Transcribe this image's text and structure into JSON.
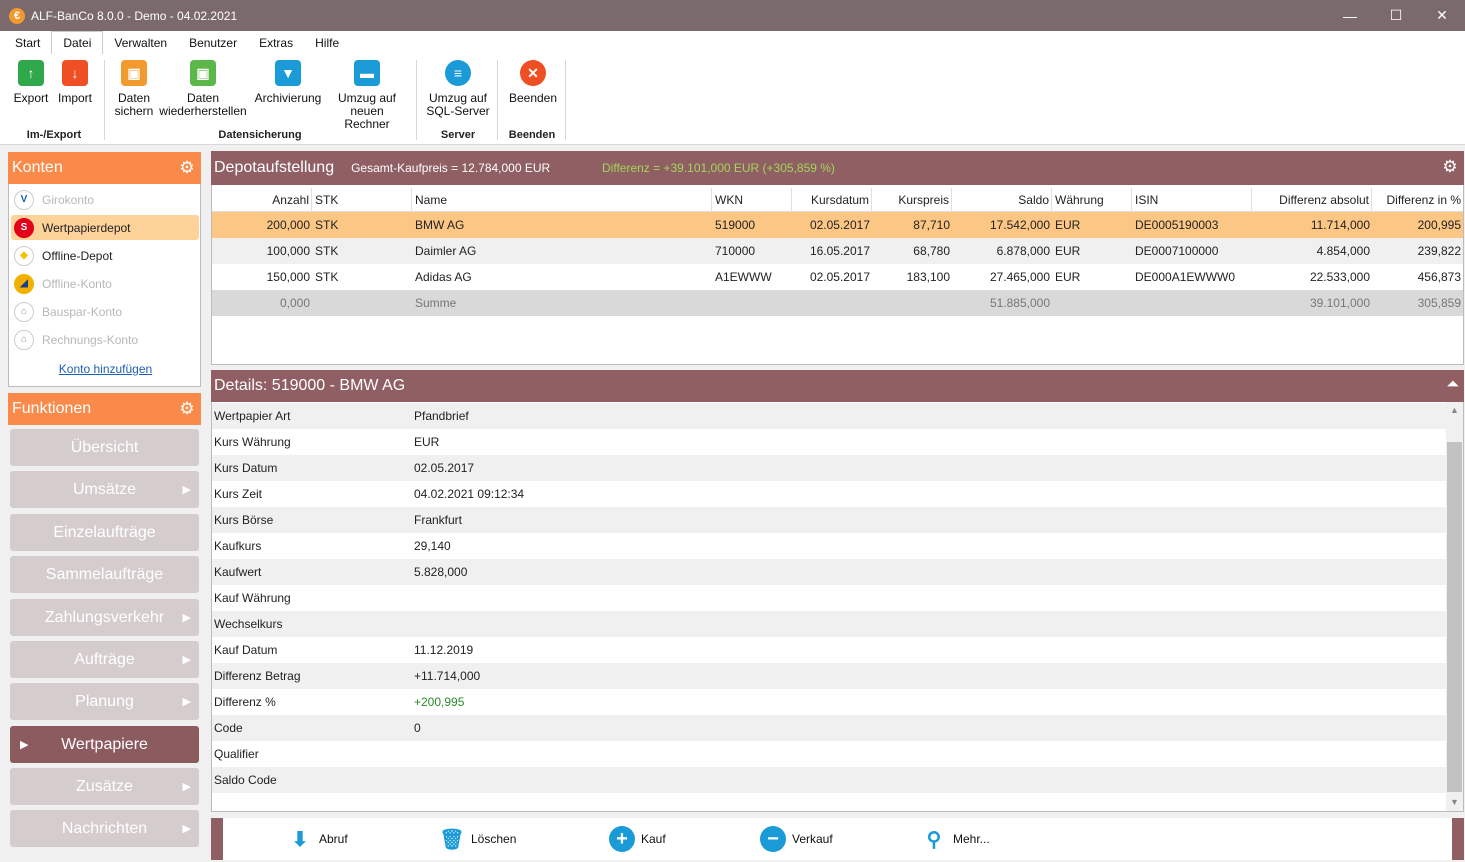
{
  "window": {
    "title": "ALF-BanCo 8.0.0 - Demo  -  04.02.2021",
    "app_icon": "euro-icon",
    "minimize": "—",
    "maximize": "☐",
    "close": "✕"
  },
  "menu": [
    "Start",
    "Datei",
    "Verwalten",
    "Benutzer",
    "Extras",
    "Hilfe"
  ],
  "ribbon": {
    "groups": {
      "imexport": "Im-/Export",
      "datensicherung": "Datensicherung",
      "server": "Server",
      "beenden": "Beenden"
    },
    "buttons": {
      "export": "Export",
      "import": "Import",
      "daten_sichern_1": "Daten",
      "daten_sichern_2": "sichern",
      "daten_wieder_1": "Daten",
      "daten_wieder_2": "wiederherstellen",
      "archivierung": "Archivierung",
      "umzug_1": "Umzug auf",
      "umzug_2": "neuen Rechner",
      "sql_1": "Umzug auf",
      "sql_2": "SQL-Server",
      "beenden": "Beenden"
    },
    "colors": {
      "green": "#2ea84a",
      "orange": "#f39a2e",
      "blue": "#1a9ad6",
      "red": "#f04e23"
    }
  },
  "konten": {
    "title": "Konten",
    "items": [
      {
        "label": "Girokonto",
        "icon": "volksbank-icon",
        "state": "dim"
      },
      {
        "label": "Wertpapierdepot",
        "icon": "sparkasse-icon",
        "state": "selected"
      },
      {
        "label": "Offline-Depot",
        "icon": "commerzbank-icon",
        "state": "normal"
      },
      {
        "label": "Offline-Konto",
        "icon": "bank-logo-icon",
        "state": "dim"
      },
      {
        "label": "Bauspar-Konto",
        "icon": "bank-building-icon",
        "state": "dim"
      },
      {
        "label": "Rechnungs-Konto",
        "icon": "bank-building-icon",
        "state": "dim"
      }
    ],
    "add_link": "Konto hinzufügen"
  },
  "funktionen": {
    "title": "Funktionen",
    "items": [
      {
        "label": "Übersicht",
        "arrow": false
      },
      {
        "label": "Umsätze",
        "arrow": true
      },
      {
        "label": "Einzelaufträge",
        "arrow": false
      },
      {
        "label": "Sammelaufträge",
        "arrow": false
      },
      {
        "label": "Zahlungsverkehr",
        "arrow": true
      },
      {
        "label": "Aufträge",
        "arrow": true
      },
      {
        "label": "Planung",
        "arrow": true
      },
      {
        "label": "Wertpapiere",
        "arrow": false,
        "active": true
      },
      {
        "label": "Zusätze",
        "arrow": true
      },
      {
        "label": "Nachrichten",
        "arrow": true
      }
    ]
  },
  "depot": {
    "title": "Depotaufstellung",
    "summary": "Gesamt-Kaufpreis = 12.784,000 EUR",
    "difference": "Differenz = +39.101,000 EUR (+305,859 %)",
    "columns": [
      "Anzahl",
      "STK",
      "Name",
      "WKN",
      "Kursdatum",
      "Kurspreis",
      "Saldo",
      "Währung",
      "ISIN",
      "Differenz absolut",
      "Differenz in %"
    ],
    "rows": [
      [
        "200,000",
        "STK",
        "BMW AG",
        "519000",
        "02.05.2017",
        "87,710",
        "17.542,000",
        "EUR",
        "DE0005190003",
        "11.714,000",
        "200,995"
      ],
      [
        "100,000",
        "STK",
        "Daimler AG",
        "710000",
        "16.05.2017",
        "68,780",
        "6.878,000",
        "EUR",
        "DE0007100000",
        "4.854,000",
        "239,822"
      ],
      [
        "150,000",
        "STK",
        "Adidas AG",
        "A1EWWW",
        "02.05.2017",
        "183,100",
        "27.465,000",
        "EUR",
        "DE000A1EWWW0",
        "22.533,000",
        "456,873"
      ]
    ],
    "sum_row": {
      "anzahl": "0,000",
      "name": "Summe",
      "saldo": "51.885,000",
      "diff_abs": "39.101,000",
      "diff_pct": "305,859"
    }
  },
  "details": {
    "title": "Details: 519000 - BMW AG",
    "rows": [
      {
        "key": "Wertpapier Art",
        "value": "Pfandbrief"
      },
      {
        "key": "Kurs Währung",
        "value": "EUR"
      },
      {
        "key": "Kurs Datum",
        "value": "02.05.2017"
      },
      {
        "key": "Kurs Zeit",
        "value": "04.02.2021 09:12:34"
      },
      {
        "key": "Kurs Börse",
        "value": "Frankfurt"
      },
      {
        "key": "Kaufkurs",
        "value": "29,140"
      },
      {
        "key": "Kaufwert",
        "value": "5.828,000"
      },
      {
        "key": "Kauf Währung",
        "value": ""
      },
      {
        "key": "Wechselkurs",
        "value": ""
      },
      {
        "key": "Kauf Datum",
        "value": "11.12.2019"
      },
      {
        "key": "Differenz Betrag",
        "value": "+11.714,000"
      },
      {
        "key": "Differenz %",
        "value": "+200,995",
        "green": true
      },
      {
        "key": "Code",
        "value": "0"
      },
      {
        "key": "Qualifier",
        "value": ""
      },
      {
        "key": "Saldo Code",
        "value": ""
      }
    ]
  },
  "bottom": {
    "abruf": "Abruf",
    "loeschen": "Löschen",
    "kauf": "Kauf",
    "verkauf": "Verkauf",
    "mehr": "Mehr..."
  }
}
